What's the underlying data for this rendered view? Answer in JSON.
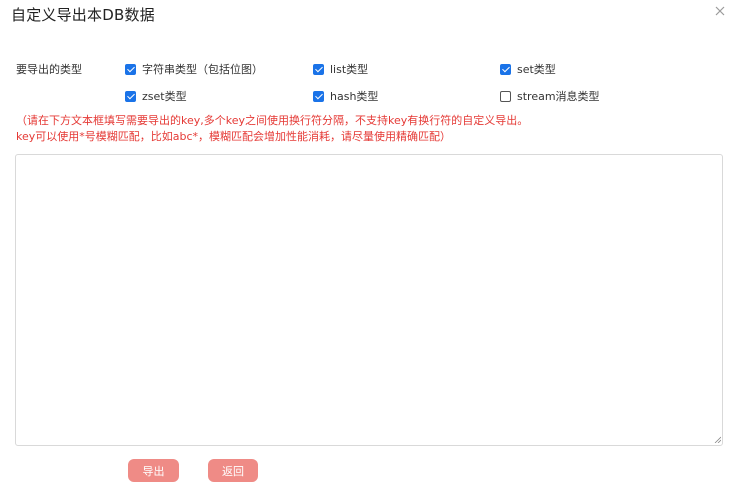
{
  "dialog": {
    "title": "自定义导出本DB数据",
    "close_icon": "close-icon"
  },
  "types": {
    "label": "要导出的类型",
    "options": [
      {
        "label": "字符串类型（包括位图）",
        "checked": true
      },
      {
        "label": "list类型",
        "checked": true
      },
      {
        "label": "set类型",
        "checked": true
      },
      {
        "label": "zset类型",
        "checked": true
      },
      {
        "label": "hash类型",
        "checked": true
      },
      {
        "label": "stream消息类型",
        "checked": false
      }
    ]
  },
  "hint": {
    "line1": "（请在下方文本框填写需要导出的key,多个key之间使用换行符分隔，不支持key有换行符的自定义导出。",
    "line2": "key可以使用*号模糊匹配，比如abc*，模糊匹配会增加性能消耗，请尽量使用精确匹配）"
  },
  "keys_input": {
    "value": ""
  },
  "buttons": {
    "export_label": "导出",
    "back_label": "返回"
  },
  "colors": {
    "accent": "#1a73e8",
    "warning_text": "#e53935",
    "button": "#ef8b86"
  }
}
